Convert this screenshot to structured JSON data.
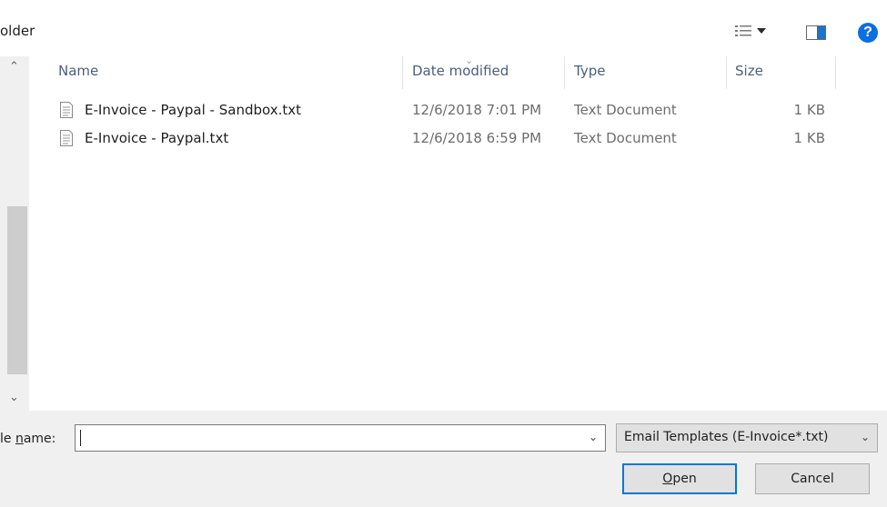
{
  "toolbar": {
    "breadcrumb": "older",
    "views_icon": "details-view-icon",
    "preview_icon": "preview-pane-icon",
    "help_icon": "help-icon",
    "help_label": "?"
  },
  "columns": {
    "name": "Name",
    "date_modified": "Date modified",
    "type": "Type",
    "size": "Size"
  },
  "files": [
    {
      "name": "E-Invoice - Paypal - Sandbox.txt",
      "date": "12/6/2018 7:01 PM",
      "type": "Text Document",
      "size": "1 KB"
    },
    {
      "name": "E-Invoice - Paypal.txt",
      "date": "12/6/2018 6:59 PM",
      "type": "Text Document",
      "size": "1 KB"
    }
  ],
  "footer": {
    "filename_label_prefix": "le ",
    "filename_label_access": "n",
    "filename_label_rest": "ame:",
    "filename_value": "",
    "filetype_value": "Email Templates (E-Invoice*.txt)",
    "open_access": "O",
    "open_rest": "pen",
    "cancel_label": "Cancel"
  },
  "colors": {
    "accent": "#0078d7",
    "help": "#0c6ee0",
    "header_text": "#4c607a"
  }
}
